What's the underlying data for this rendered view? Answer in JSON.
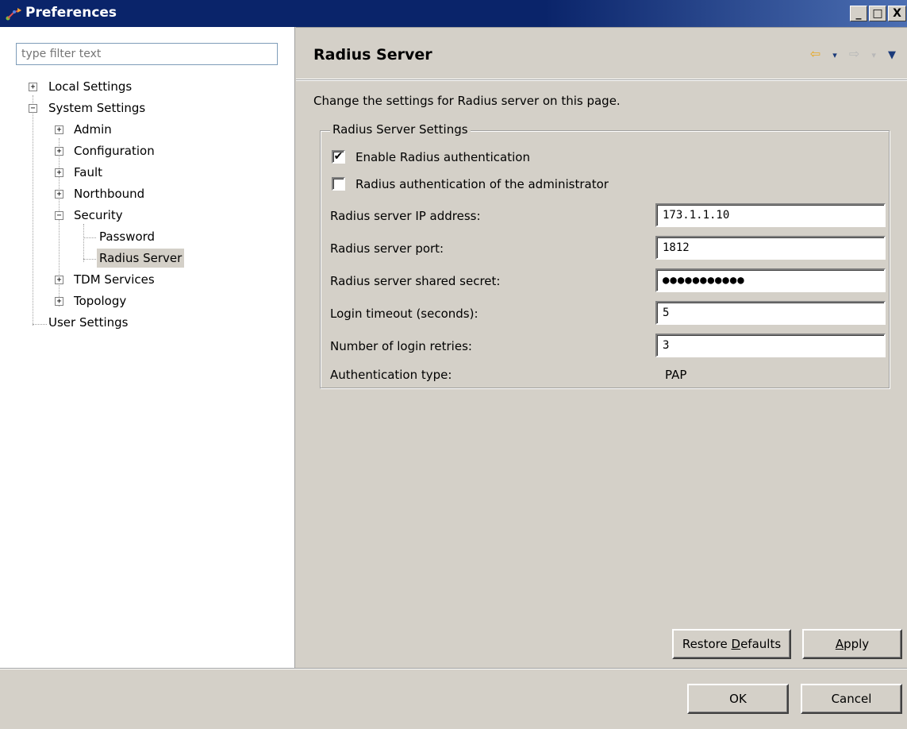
{
  "window": {
    "title": "Preferences",
    "minimize": "_",
    "maximize": "□",
    "close": "X"
  },
  "filter": {
    "placeholder": "type filter text"
  },
  "tree": [
    {
      "label": "Local Settings",
      "expander": "+"
    },
    {
      "label": "System Settings",
      "expander": "−"
    },
    {
      "label": "Admin",
      "expander": "+"
    },
    {
      "label": "Configuration",
      "expander": "+"
    },
    {
      "label": "Fault",
      "expander": "+"
    },
    {
      "label": "Northbound",
      "expander": "+"
    },
    {
      "label": "Security",
      "expander": "−"
    },
    {
      "label": "Password"
    },
    {
      "label": "Radius Server"
    },
    {
      "label": "TDM Services",
      "expander": "+"
    },
    {
      "label": "Topology",
      "expander": "+"
    },
    {
      "label": "User Settings"
    }
  ],
  "page": {
    "title": "Radius Server",
    "description": "Change the settings for Radius server on this page.",
    "nav": {
      "back": "⇦",
      "back_menu": "▾",
      "forward": "⇨",
      "forward_menu": "▾",
      "view_menu": "▼"
    }
  },
  "group": {
    "legend": "Radius Server Settings",
    "enable_radius": {
      "label": "Enable Radius authentication",
      "checked": true,
      "mark": "✔"
    },
    "admin_auth": {
      "label": "Radius authentication of the administrator",
      "checked": false,
      "mark": ""
    },
    "fields": {
      "ip_label": "Radius server IP address:",
      "ip_value": "173.1.1.10",
      "port_label": "Radius server port:",
      "port_value": "1812",
      "secret_label": "Radius server shared secret:",
      "secret_value": "●●●●●●●●●●●",
      "timeout_label": "Login timeout (seconds):",
      "timeout_value": "5",
      "retries_label": "Number of login retries:",
      "retries_value": "3",
      "auth_type_label": "Authentication type:",
      "auth_type_value": "PAP"
    }
  },
  "buttons": {
    "restore_pre": "Restore ",
    "restore_ul": "D",
    "restore_post": "efaults",
    "apply_ul": "A",
    "apply_post": "pply",
    "ok": "OK",
    "cancel": "Cancel"
  },
  "colors": {
    "title_bar": "#0a246a",
    "dialog_bg": "#d4d0c8",
    "nav_arrow": "#e8a820"
  }
}
